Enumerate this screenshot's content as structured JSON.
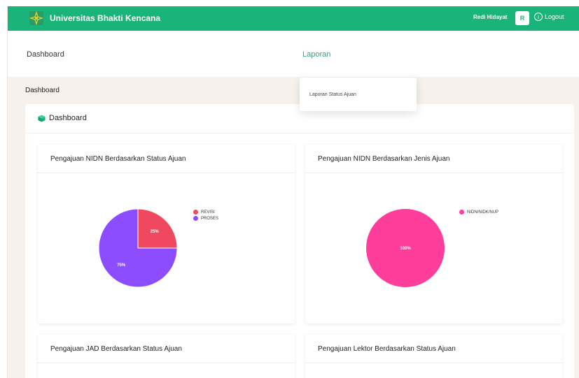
{
  "header": {
    "brand": "Universitas Bhakti Kencana",
    "user_name": "Redi Hidayat",
    "avatar_initial": "R",
    "logout_label": "Logout"
  },
  "nav": {
    "items": [
      {
        "label": "Dashboard"
      },
      {
        "label": "Laporan"
      }
    ],
    "dropdown": [
      "Laporan Status Ajuan"
    ]
  },
  "page": {
    "heading": "Dashboard",
    "panel_title": "Dashboard"
  },
  "colors": {
    "brand": "#1ab37a",
    "revisi": "#f0485f",
    "proses": "#8b4dff",
    "nidn": "#ff3d9a"
  },
  "icons": [
    "logo-icon",
    "info-circle-icon",
    "cube-icon"
  ],
  "cards": [
    {
      "title": "Pengajuan NIDN Berdasarkan Status Ajuan"
    },
    {
      "title": "Pengajuan NIDN Berdasarkan Jenis Ajuan"
    },
    {
      "title": "Pengajuan JAD Berdasarkan Status Ajuan"
    },
    {
      "title": "Pengajuan Lektor Berdasarkan Status Ajuan"
    }
  ],
  "chart_data": [
    {
      "type": "pie",
      "title": "Pengajuan NIDN Berdasarkan Status Ajuan",
      "categories": [
        "REVISI",
        "PROSES"
      ],
      "values": [
        25,
        75
      ],
      "labels": [
        "25%",
        "75%"
      ],
      "colors": [
        "#f0485f",
        "#8b4dff"
      ],
      "legend": "top-right"
    },
    {
      "type": "pie",
      "title": "Pengajuan NIDN Berdasarkan Jenis Ajuan",
      "categories": [
        "NIDN/NIDK/NUP"
      ],
      "values": [
        100
      ],
      "labels": [
        "100%"
      ],
      "colors": [
        "#ff3d9a"
      ],
      "legend": "top-right"
    }
  ]
}
